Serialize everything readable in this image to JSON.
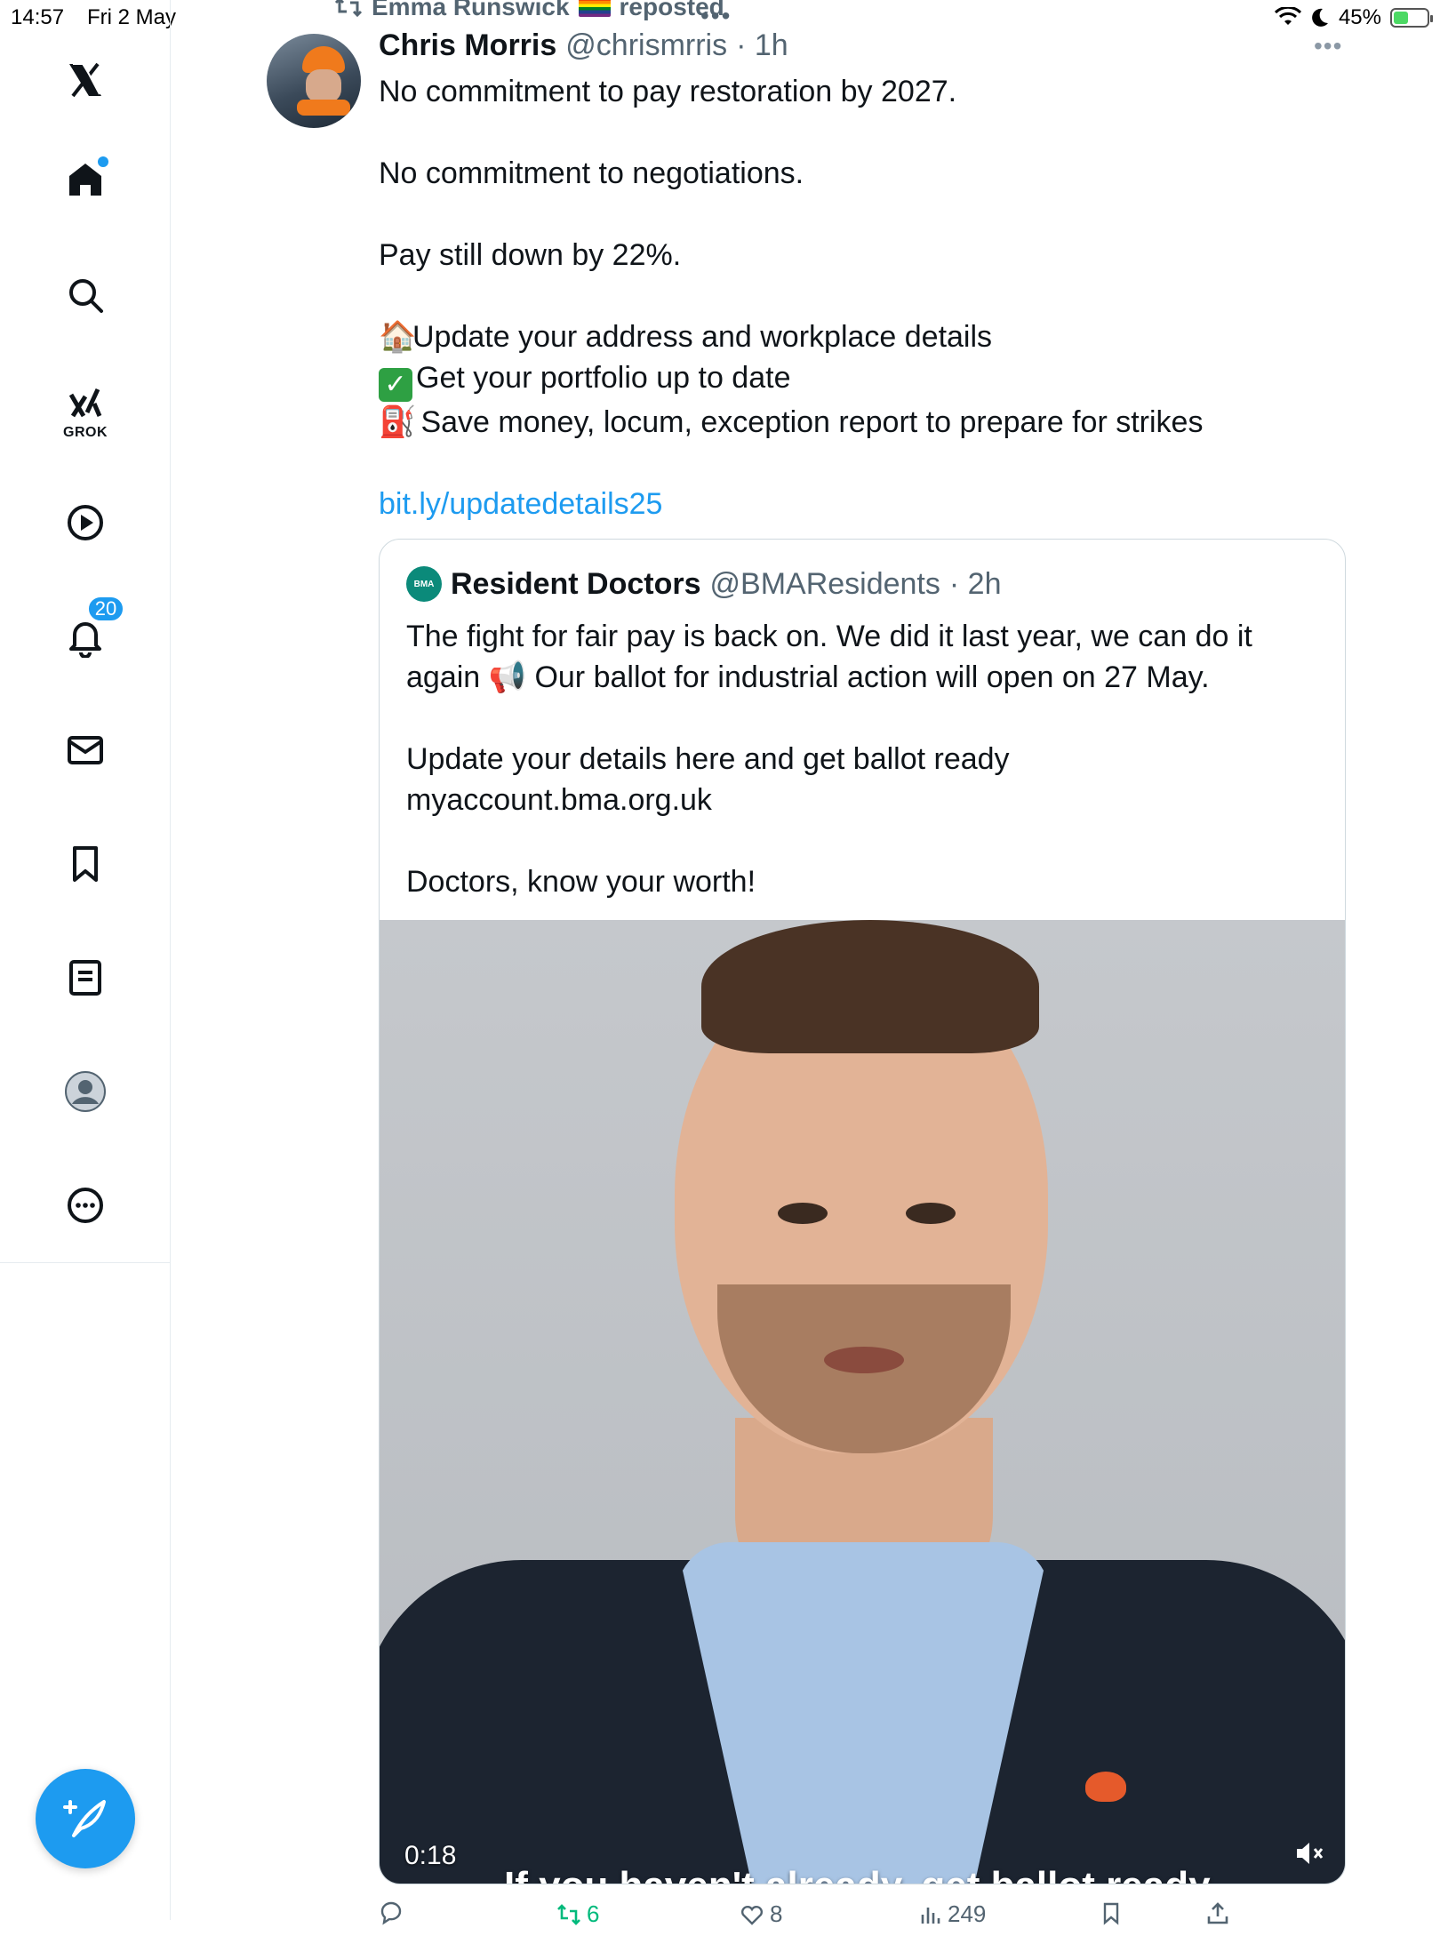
{
  "status_bar": {
    "time": "14:57",
    "date": "Fri 2 May",
    "battery_percent": "45%",
    "battery_level": 0.45
  },
  "sidebar": {
    "items": [
      {
        "icon": "x-logo-icon",
        "label": ""
      },
      {
        "icon": "home-icon",
        "label": "",
        "has_dot": true
      },
      {
        "icon": "search-icon",
        "label": ""
      },
      {
        "icon": "grok-icon",
        "label": "GROK"
      },
      {
        "icon": "play-icon",
        "label": ""
      },
      {
        "icon": "bell-icon",
        "label": "",
        "badge": "20"
      },
      {
        "icon": "mail-icon",
        "label": ""
      },
      {
        "icon": "bookmark-icon",
        "label": ""
      },
      {
        "icon": "list-icon",
        "label": ""
      },
      {
        "icon": "profile-icon",
        "label": ""
      },
      {
        "icon": "more-icon",
        "label": ""
      }
    ],
    "notifications_badge": "20",
    "grok_label": "GROK",
    "compose_icon": "compose-icon",
    "accent_color": "#1d9bf0"
  },
  "repost": {
    "user": "Emma Runswick",
    "label": "reposted"
  },
  "tweet": {
    "author_name": "Chris Morris",
    "author_handle": "@chrismrris",
    "time": "· 1h",
    "lines": [
      "No commitment to pay restoration by 2027.",
      "No commitment to negotiations.",
      "Pay still down by 22%.",
      "Update your address and workplace details",
      "Get your portfolio up to date",
      "Save money, locum, exception report to prepare for strikes"
    ],
    "link": "bit.ly/updatedetails25"
  },
  "quote": {
    "author_name": "Resident Doctors",
    "author_handle": "@BMAResidents",
    "time": "· 2h",
    "logo_text": "BMA",
    "line1": "The fight for fair pay is back on. We did it last year, we can do it",
    "line2": "again",
    "line2_rest": "Our ballot for industrial action will open on 27 May.",
    "line3": "Update your details here and get ballot ready",
    "line4": "myaccount.bma.org.uk",
    "line5": "Doctors, know your worth!"
  },
  "video": {
    "duration": "0:18",
    "caption": "If you haven't already, get ballot ready"
  },
  "actions": {
    "replies": "",
    "retweets": "6",
    "likes": "8",
    "views": "249",
    "retweet_color": "#00ba7c"
  }
}
